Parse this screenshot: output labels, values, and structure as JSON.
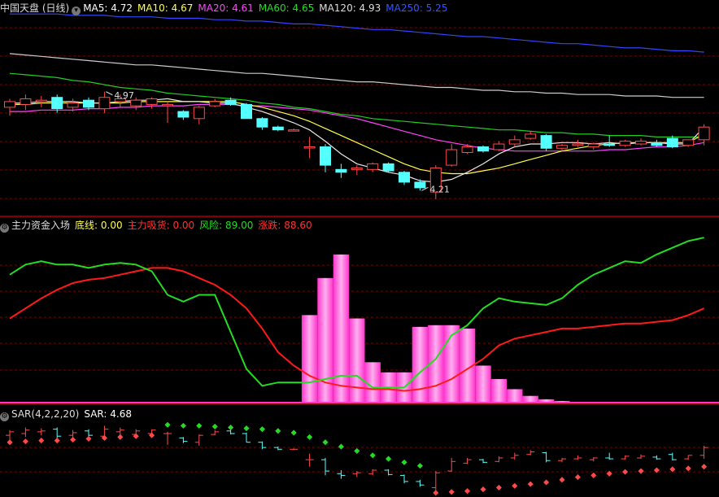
{
  "colors": {
    "up": "#ff4a4a",
    "down": "#54ffff",
    "grid": "#7a0000",
    "ma5": "#e8e8e8",
    "ma10": "#ffff4a",
    "ma20": "#ff44ff",
    "ma60": "#22cc22",
    "ma120": "#cccccc",
    "ma250": "#3344ff",
    "green": "#22dd22",
    "red": "#ff1a1a",
    "magenta": "#ff33cc"
  },
  "panels": {
    "main": {
      "title": "中国天盘 (日线)",
      "icon": "chevron-down-icon",
      "items": [
        {
          "label": "MA5: 4.72",
          "color": "#ffffff"
        },
        {
          "label": "MA10: 4.67",
          "color": "#ffff4a"
        },
        {
          "label": "MA20: 4.61",
          "color": "#ff44ff"
        },
        {
          "label": "MA60: 4.65",
          "color": "#22dd22"
        },
        {
          "label": "MA120: 4.93",
          "color": "#dddddd"
        },
        {
          "label": "MA250: 5.25",
          "color": "#3355ff"
        }
      ]
    },
    "fund": {
      "title": "主力资金入场",
      "icon": "gear-icon",
      "items": [
        {
          "label": "底线: 0.00",
          "color": "#ffff4a"
        },
        {
          "label": "主力吸货: 0.00",
          "color": "#ff3333"
        },
        {
          "label": "风险: 89.00",
          "color": "#22dd22"
        },
        {
          "label": "涨跌: 88.60",
          "color": "#ff3333"
        }
      ]
    },
    "sar": {
      "title": "SAR(4,2,2,20)",
      "icon": "gear-icon",
      "items": [
        {
          "label": "SAR: 4.68",
          "color": "#ffffff"
        }
      ]
    }
  },
  "chart_data": [
    {
      "type": "candlestick",
      "annotations": [
        {
          "label": "4.97",
          "index": 6
        },
        {
          "label": "4.21",
          "index": 26
        }
      ],
      "candles": [
        {
          "o": 4.86,
          "h": 4.92,
          "l": 4.8,
          "c": 4.9
        },
        {
          "o": 4.88,
          "h": 4.95,
          "l": 4.84,
          "c": 4.92
        },
        {
          "o": 4.9,
          "h": 4.94,
          "l": 4.86,
          "c": 4.91
        },
        {
          "o": 4.93,
          "h": 4.95,
          "l": 4.82,
          "c": 4.85
        },
        {
          "o": 4.86,
          "h": 4.92,
          "l": 4.83,
          "c": 4.89
        },
        {
          "o": 4.91,
          "h": 4.93,
          "l": 4.84,
          "c": 4.86
        },
        {
          "o": 4.85,
          "h": 4.97,
          "l": 4.82,
          "c": 4.93
        },
        {
          "o": 4.9,
          "h": 4.95,
          "l": 4.86,
          "c": 4.92
        },
        {
          "o": 4.87,
          "h": 4.93,
          "l": 4.84,
          "c": 4.91
        },
        {
          "o": 4.88,
          "h": 4.93,
          "l": 4.85,
          "c": 4.92
        },
        {
          "o": 4.88,
          "h": 4.9,
          "l": 4.75,
          "c": 4.88
        },
        {
          "o": 4.83,
          "h": 4.84,
          "l": 4.77,
          "c": 4.79
        },
        {
          "o": 4.78,
          "h": 4.87,
          "l": 4.74,
          "c": 4.86
        },
        {
          "o": 4.87,
          "h": 4.92,
          "l": 4.86,
          "c": 4.9
        },
        {
          "o": 4.91,
          "h": 4.93,
          "l": 4.87,
          "c": 4.88
        },
        {
          "o": 4.88,
          "h": 4.89,
          "l": 4.78,
          "c": 4.78
        },
        {
          "o": 4.78,
          "h": 4.79,
          "l": 4.7,
          "c": 4.72
        },
        {
          "o": 4.72,
          "h": 4.73,
          "l": 4.69,
          "c": 4.7
        },
        {
          "o": 4.7,
          "h": 4.71,
          "l": 4.69,
          "c": 4.7
        },
        {
          "o": 4.58,
          "h": 4.65,
          "l": 4.5,
          "c": 4.58
        },
        {
          "o": 4.58,
          "h": 4.6,
          "l": 4.4,
          "c": 4.45
        },
        {
          "o": 4.42,
          "h": 4.46,
          "l": 4.36,
          "c": 4.4
        },
        {
          "o": 4.42,
          "h": 4.45,
          "l": 4.38,
          "c": 4.43
        },
        {
          "o": 4.42,
          "h": 4.47,
          "l": 4.4,
          "c": 4.46
        },
        {
          "o": 4.46,
          "h": 4.47,
          "l": 4.4,
          "c": 4.41
        },
        {
          "o": 4.4,
          "h": 4.41,
          "l": 4.31,
          "c": 4.33
        },
        {
          "o": 4.33,
          "h": 4.35,
          "l": 4.27,
          "c": 4.29
        },
        {
          "o": 4.26,
          "h": 4.45,
          "l": 4.21,
          "c": 4.43
        },
        {
          "o": 4.45,
          "h": 4.6,
          "l": 4.44,
          "c": 4.56
        },
        {
          "o": 4.54,
          "h": 4.6,
          "l": 4.53,
          "c": 4.58
        },
        {
          "o": 4.58,
          "h": 4.59,
          "l": 4.54,
          "c": 4.55
        },
        {
          "o": 4.56,
          "h": 4.62,
          "l": 4.55,
          "c": 4.6
        },
        {
          "o": 4.6,
          "h": 4.66,
          "l": 4.58,
          "c": 4.63
        },
        {
          "o": 4.64,
          "h": 4.69,
          "l": 4.63,
          "c": 4.67
        },
        {
          "o": 4.66,
          "h": 4.67,
          "l": 4.55,
          "c": 4.57
        },
        {
          "o": 4.57,
          "h": 4.6,
          "l": 4.55,
          "c": 4.59
        },
        {
          "o": 4.59,
          "h": 4.63,
          "l": 4.58,
          "c": 4.6
        },
        {
          "o": 4.58,
          "h": 4.61,
          "l": 4.56,
          "c": 4.6
        },
        {
          "o": 4.6,
          "h": 4.66,
          "l": 4.58,
          "c": 4.59
        },
        {
          "o": 4.59,
          "h": 4.63,
          "l": 4.58,
          "c": 4.62
        },
        {
          "o": 4.6,
          "h": 4.64,
          "l": 4.59,
          "c": 4.62
        },
        {
          "o": 4.61,
          "h": 4.63,
          "l": 4.58,
          "c": 4.59
        },
        {
          "o": 4.64,
          "h": 4.66,
          "l": 4.57,
          "c": 4.58
        },
        {
          "o": 4.59,
          "h": 4.63,
          "l": 4.58,
          "c": 4.63
        },
        {
          "o": 4.63,
          "h": 4.74,
          "l": 4.59,
          "c": 4.72
        }
      ],
      "ma5": [
        4.89,
        4.89,
        4.9,
        4.9,
        4.9,
        4.89,
        4.89,
        4.9,
        4.91,
        4.91,
        4.92,
        4.9,
        4.9,
        4.89,
        4.89,
        4.86,
        4.83,
        4.79,
        4.75,
        4.7,
        4.62,
        4.53,
        4.46,
        4.43,
        4.4,
        4.38,
        4.34,
        4.33,
        4.35,
        4.4,
        4.46,
        4.53,
        4.58,
        4.6,
        4.6,
        4.61,
        4.61,
        4.6,
        4.61,
        4.6,
        4.61,
        4.61,
        4.6,
        4.6,
        4.72
      ],
      "ma10": [
        4.88,
        4.88,
        4.89,
        4.89,
        4.89,
        4.89,
        4.89,
        4.89,
        4.9,
        4.9,
        4.9,
        4.9,
        4.9,
        4.9,
        4.9,
        4.88,
        4.86,
        4.83,
        4.8,
        4.76,
        4.71,
        4.66,
        4.61,
        4.56,
        4.51,
        4.46,
        4.42,
        4.4,
        4.39,
        4.39,
        4.41,
        4.43,
        4.46,
        4.49,
        4.52,
        4.55,
        4.57,
        4.59,
        4.6,
        4.61,
        4.61,
        4.61,
        4.61,
        4.61,
        4.67
      ],
      "ma20": [
        4.83,
        4.83,
        4.84,
        4.84,
        4.84,
        4.85,
        4.85,
        4.86,
        4.86,
        4.87,
        4.87,
        4.87,
        4.88,
        4.88,
        4.88,
        4.87,
        4.87,
        4.86,
        4.85,
        4.84,
        4.82,
        4.8,
        4.78,
        4.75,
        4.72,
        4.69,
        4.66,
        4.63,
        4.61,
        4.59,
        4.57,
        4.56,
        4.55,
        4.55,
        4.55,
        4.55,
        4.55,
        4.55,
        4.56,
        4.56,
        4.57,
        4.58,
        4.58,
        4.59,
        4.61
      ],
      "ma60": [
        5.1,
        5.09,
        5.08,
        5.07,
        5.05,
        5.04,
        5.02,
        5.0,
        4.99,
        4.98,
        4.96,
        4.95,
        4.94,
        4.93,
        4.92,
        4.91,
        4.89,
        4.88,
        4.86,
        4.85,
        4.83,
        4.81,
        4.8,
        4.78,
        4.77,
        4.76,
        4.75,
        4.74,
        4.73,
        4.72,
        4.71,
        4.7,
        4.7,
        4.69,
        4.68,
        4.68,
        4.67,
        4.67,
        4.66,
        4.66,
        4.66,
        4.65,
        4.65,
        4.65,
        4.65
      ],
      "ma120": [
        5.24,
        5.23,
        5.22,
        5.21,
        5.2,
        5.19,
        5.18,
        5.17,
        5.16,
        5.16,
        5.15,
        5.14,
        5.13,
        5.12,
        5.11,
        5.1,
        5.1,
        5.09,
        5.08,
        5.07,
        5.06,
        5.05,
        5.04,
        5.04,
        5.03,
        5.02,
        5.01,
        5.0,
        5.0,
        4.99,
        4.98,
        4.98,
        4.97,
        4.97,
        4.96,
        4.96,
        4.95,
        4.95,
        4.95,
        4.94,
        4.94,
        4.94,
        4.93,
        4.93,
        4.93
      ],
      "ma250": [
        5.52,
        5.52,
        5.52,
        5.52,
        5.51,
        5.51,
        5.51,
        5.5,
        5.5,
        5.5,
        5.49,
        5.49,
        5.49,
        5.48,
        5.48,
        5.47,
        5.47,
        5.46,
        5.45,
        5.45,
        5.44,
        5.43,
        5.42,
        5.41,
        5.41,
        5.4,
        5.39,
        5.38,
        5.37,
        5.36,
        5.36,
        5.35,
        5.34,
        5.33,
        5.32,
        5.31,
        5.31,
        5.3,
        5.29,
        5.28,
        5.28,
        5.27,
        5.26,
        5.26,
        5.25
      ]
    },
    {
      "type": "bar_line",
      "ylim": [
        0,
        100
      ],
      "bars": [
        0,
        0,
        0,
        0,
        0,
        0,
        0,
        0,
        0,
        0,
        0,
        0,
        0,
        0,
        0,
        0,
        0,
        0,
        0,
        52,
        74,
        88,
        50,
        24,
        18,
        18,
        45,
        46,
        46,
        44,
        22,
        14,
        8,
        4,
        2,
        1,
        0,
        0,
        0,
        0,
        0,
        0,
        0,
        0,
        0
      ],
      "green": [
        76,
        82,
        84,
        82,
        82,
        80,
        82,
        83,
        82,
        78,
        64,
        60,
        64,
        64,
        42,
        20,
        10,
        12,
        12,
        12,
        14,
        16,
        16,
        9,
        9,
        9,
        18,
        26,
        40,
        46,
        56,
        62,
        60,
        59,
        58,
        62,
        70,
        76,
        80,
        84,
        83,
        88,
        92,
        96,
        98
      ],
      "red": [
        50,
        56,
        62,
        67,
        71,
        73,
        74,
        76,
        78,
        80,
        80,
        78,
        74,
        70,
        64,
        56,
        44,
        30,
        22,
        16,
        12,
        10,
        9,
        8,
        8,
        7,
        8,
        10,
        14,
        20,
        26,
        34,
        38,
        40,
        42,
        44,
        44,
        45,
        46,
        47,
        47,
        48,
        49,
        52,
        56
      ]
    },
    {
      "type": "sar",
      "sar": [
        4.78,
        4.79,
        4.8,
        4.8,
        4.81,
        4.82,
        4.83,
        4.84,
        4.85,
        4.86,
        4.98,
        4.97,
        4.97,
        4.96,
        4.95,
        4.94,
        4.93,
        4.91,
        4.89,
        4.84,
        4.78,
        4.73,
        4.68,
        4.63,
        4.59,
        4.55,
        4.51,
        4.2,
        4.21,
        4.22,
        4.24,
        4.26,
        4.28,
        4.3,
        4.32,
        4.35,
        4.38,
        4.4,
        4.42,
        4.44,
        4.45,
        4.46,
        4.47,
        4.48,
        4.5
      ],
      "bull": [
        1,
        1,
        1,
        1,
        1,
        1,
        1,
        1,
        1,
        1,
        0,
        0,
        0,
        0,
        0,
        0,
        0,
        0,
        0,
        0,
        0,
        0,
        0,
        0,
        0,
        0,
        0,
        1,
        1,
        1,
        1,
        1,
        1,
        1,
        1,
        1,
        1,
        1,
        1,
        1,
        1,
        1,
        1,
        1,
        1
      ]
    }
  ]
}
